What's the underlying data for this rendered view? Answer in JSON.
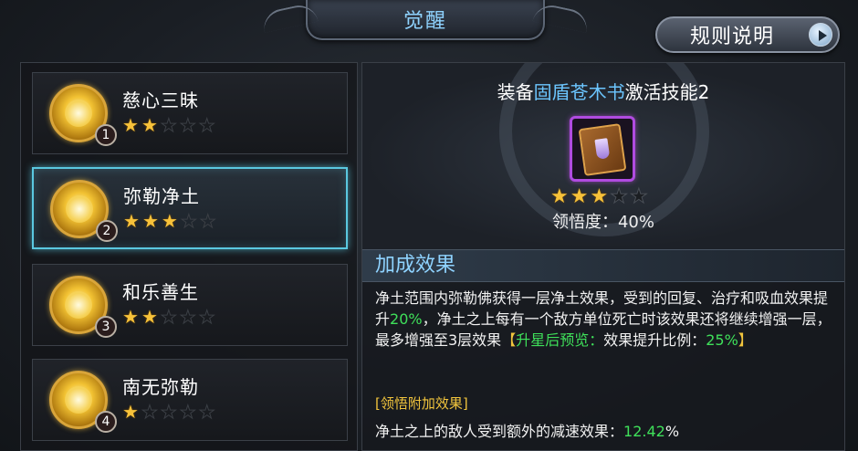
{
  "title": "觉醒",
  "rules_button": {
    "label": "规则说明",
    "icon": "play-arrow-icon"
  },
  "skills": [
    {
      "name": "慈心三昧",
      "number": "1",
      "stars": 2,
      "max_stars": 5,
      "selected": false
    },
    {
      "name": "弥勒净土",
      "number": "2",
      "stars": 3,
      "max_stars": 5,
      "selected": true
    },
    {
      "name": "和乐善生",
      "number": "3",
      "stars": 2,
      "max_stars": 5,
      "selected": false
    },
    {
      "name": "南无弥勒",
      "number": "4",
      "stars": 1,
      "max_stars": 5,
      "selected": false
    }
  ],
  "detail": {
    "equip_prefix": "装备",
    "equip_item": "固盾苍木书",
    "equip_suffix": "激活技能2",
    "item_icon": "spellbook-icon",
    "stars": 3,
    "max_stars": 5,
    "comprehension": "领悟度：40%",
    "bonus_title": "加成效果",
    "desc": {
      "p1": "净土范围内弥勒佛获得一层净土效果，受到的回复、治疗和吸血效果提升",
      "v1": "20%",
      "p2": "，净土之上每有一个敌方单位死亡时该效果还将继续增强一层，最多增强至3层效果",
      "bracket_open": "【",
      "preview_label": "升星后预览：",
      "p3": "效果提升比例：",
      "v2": "25%",
      "bracket_close": "】"
    },
    "comp_title": "[领悟附加效果]",
    "comp_desc_prefix": "净土之上的敌人受到额外的减速效果：",
    "comp_desc_value": "12.42",
    "comp_desc_suffix": "%"
  },
  "colors": {
    "accent_blue": "#8fd3ff",
    "green": "#3fe05a",
    "star_gold": "#f7c23a",
    "selected_border": "#5ac8e0"
  }
}
